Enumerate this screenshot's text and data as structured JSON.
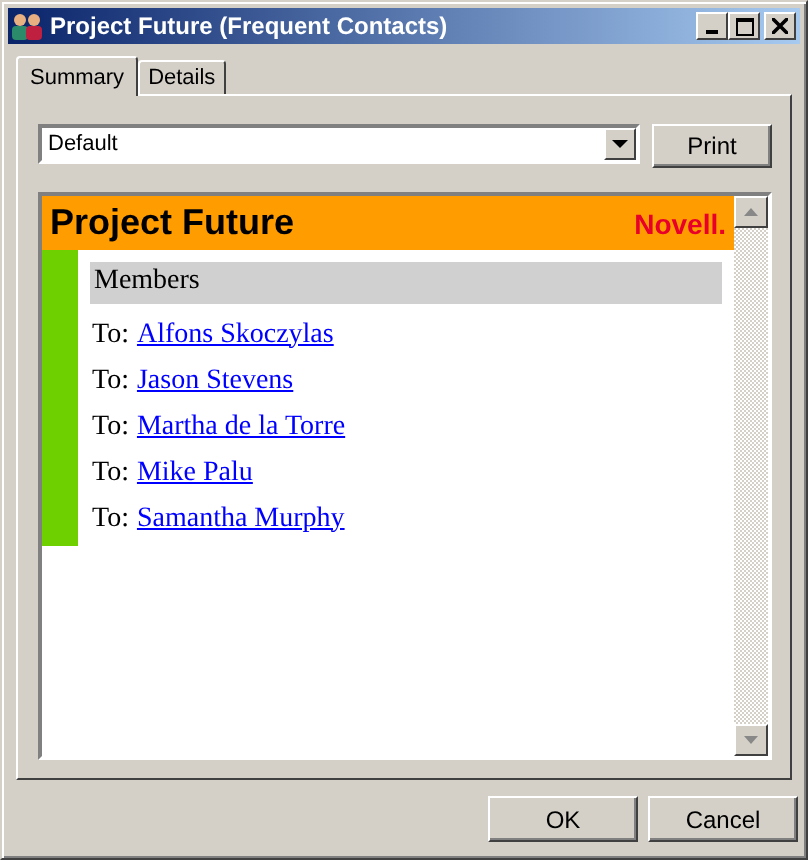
{
  "window": {
    "title": "Project Future (Frequent Contacts)"
  },
  "tabs": [
    {
      "label": "Summary",
      "selected": true
    },
    {
      "label": "Details",
      "selected": false
    }
  ],
  "view_select": {
    "value": "Default"
  },
  "print_button": "Print",
  "page": {
    "heading": "Project Future",
    "brand": "Novell.",
    "section": "Members",
    "members": [
      {
        "prefix": "To:",
        "name": "Alfons Skoczylas"
      },
      {
        "prefix": "To:",
        "name": "Jason Stevens"
      },
      {
        "prefix": "To:",
        "name": "Martha de la Torre"
      },
      {
        "prefix": "To:",
        "name": "Mike Palu"
      },
      {
        "prefix": "To:",
        "name": "Samantha Murphy"
      }
    ]
  },
  "buttons": [
    "OK",
    "Cancel"
  ]
}
